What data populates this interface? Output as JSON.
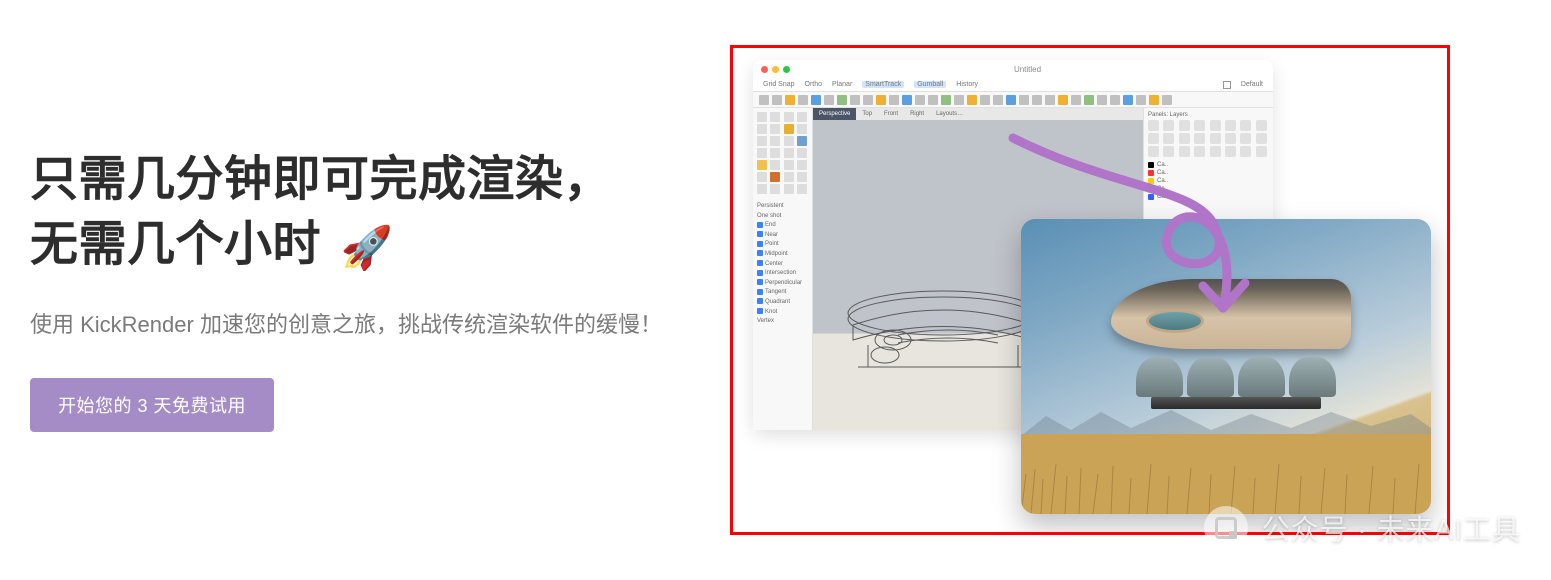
{
  "hero": {
    "heading_line1": "只需几分钟即可完成渲染，",
    "heading_line2": "无需几个小时",
    "subheading": "使用 KickRender 加速您的创意之旅，挑战传统渲染软件的缓慢！",
    "cta_label": "开始您的 3 天免费试用"
  },
  "app": {
    "title": "Untitled",
    "toprow": [
      "Grid Snap",
      "Ortho",
      "Planar",
      "SmartTrack",
      "Gumball",
      "History",
      "Default"
    ],
    "viewport_tabs": [
      "Perspective",
      "Top",
      "Front",
      "Right",
      "Layouts…"
    ],
    "option_list": [
      "Persistent",
      "One shot",
      "End",
      "Near",
      "Point",
      "Midpoint",
      "Center",
      "Intersection",
      "Perpendicular",
      "Tangent",
      "Quadrant",
      "Knot",
      "Vertex"
    ],
    "right_panel_title": "Panels: Layers",
    "layers": [
      {
        "name": "Ca..",
        "color": "#000000"
      },
      {
        "name": "Ca..",
        "color": "#ff3030"
      },
      {
        "name": "Ca..",
        "color": "#ffcc00"
      },
      {
        "name": "Ca..",
        "color": "#40b040"
      },
      {
        "name": "Ca..",
        "color": "#3060ff"
      }
    ]
  },
  "watermark": {
    "text": "公众号 · 未来AI工具"
  }
}
